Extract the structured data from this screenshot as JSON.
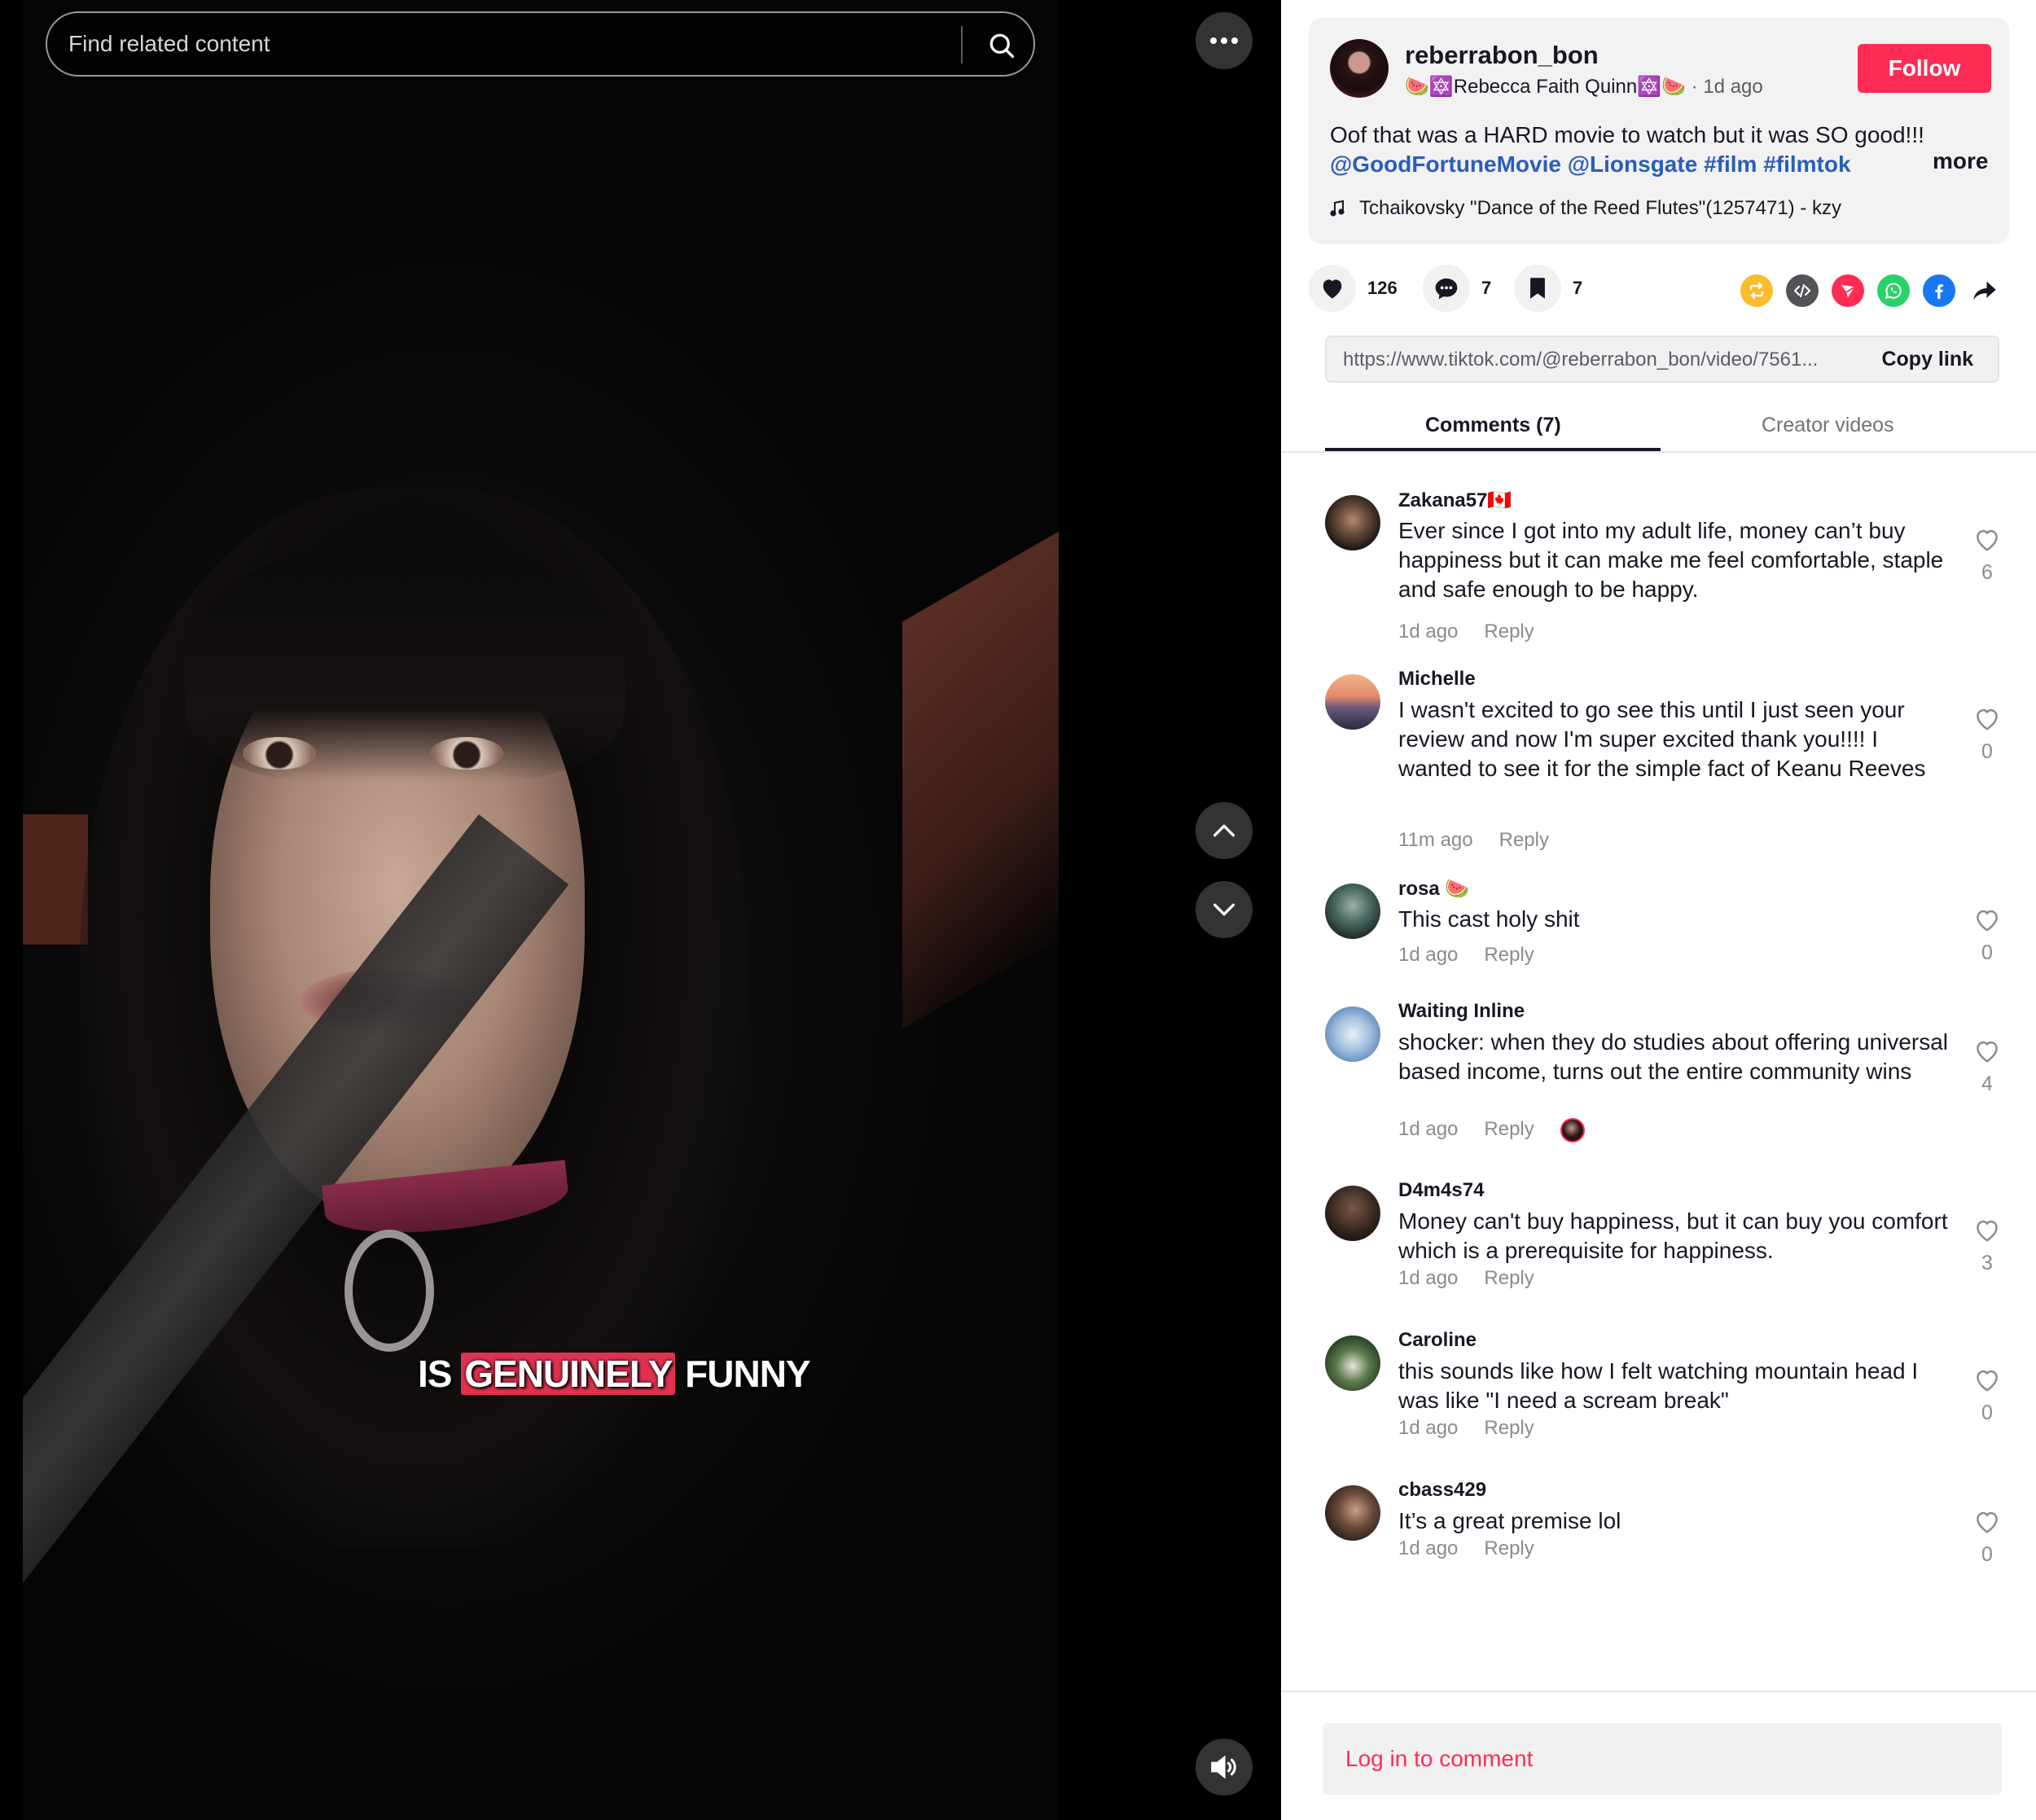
{
  "video": {
    "caption_word1": "IS",
    "caption_word2": "GENUINELY",
    "caption_word3": "FUNNY"
  },
  "search": {
    "placeholder": "Find related content"
  },
  "post": {
    "username": "reberrabon_bon",
    "display_name_prefix": "🍉🔯",
    "display_name": "Rebecca Faith Quinn",
    "display_name_suffix": "🔯🍉",
    "time": "· 1d ago",
    "follow_label": "Follow",
    "description": "Oof that was a HARD movie to watch but it was SO good!!!",
    "tags": [
      "@GoodFortuneMovie",
      "@Lionsgate",
      "#film",
      "#filmtok"
    ],
    "more_label": "more",
    "music": "Tchaikovsky \"Dance of the Reed Flutes\"(1257471) - kzy"
  },
  "actions": {
    "likes": "126",
    "comments": "7",
    "saves": "7"
  },
  "link": {
    "url": "https://www.tiktok.com/@reberrabon_bon/video/7561...",
    "copy_label": "Copy link"
  },
  "tabs": {
    "comments": "Comments (7)",
    "creator_videos": "Creator videos"
  },
  "comments": [
    {
      "user": "Zakana57🇨🇦",
      "text": "Ever since I got into my adult life, money can’t buy happiness but it can make me feel comfortable, staple and safe enough to be happy.",
      "time": "1d ago",
      "reply": "Reply",
      "likes": "6"
    },
    {
      "user": "Michelle",
      "text": "I wasn't excited to go see this until I just seen your review and now I'm super excited thank you!!!! I wanted to see it for the simple fact of Keanu Reeves",
      "time": "11m ago",
      "reply": "Reply",
      "likes": "0"
    },
    {
      "user": "rosa 🍉",
      "text": "This cast holy shit",
      "time": "1d ago",
      "reply": "Reply",
      "likes": "0"
    },
    {
      "user": "Waiting Inline",
      "text": "shocker: when they do studies about offering universal based income, turns out the entire community wins",
      "time": "1d ago",
      "reply": "Reply",
      "likes": "4"
    },
    {
      "user": "D4m4s74",
      "text": "Money can't buy happiness, but it can buy you comfort which is a prerequisite for happiness.",
      "time": "1d ago",
      "reply": "Reply",
      "likes": "3"
    },
    {
      "user": "Caroline",
      "text": "this sounds like how I felt watching mountain head I was like \"I need a scream break\"",
      "time": "1d ago",
      "reply": "Reply",
      "likes": "0"
    },
    {
      "user": "cbass429",
      "text": "It’s a great premise lol",
      "time": "1d ago",
      "reply": "Reply",
      "likes": "0"
    }
  ],
  "footer": {
    "login_label": "Log in to comment"
  },
  "colors": {
    "accent": "#fe2c55",
    "tag_link": "#2b5db9"
  }
}
